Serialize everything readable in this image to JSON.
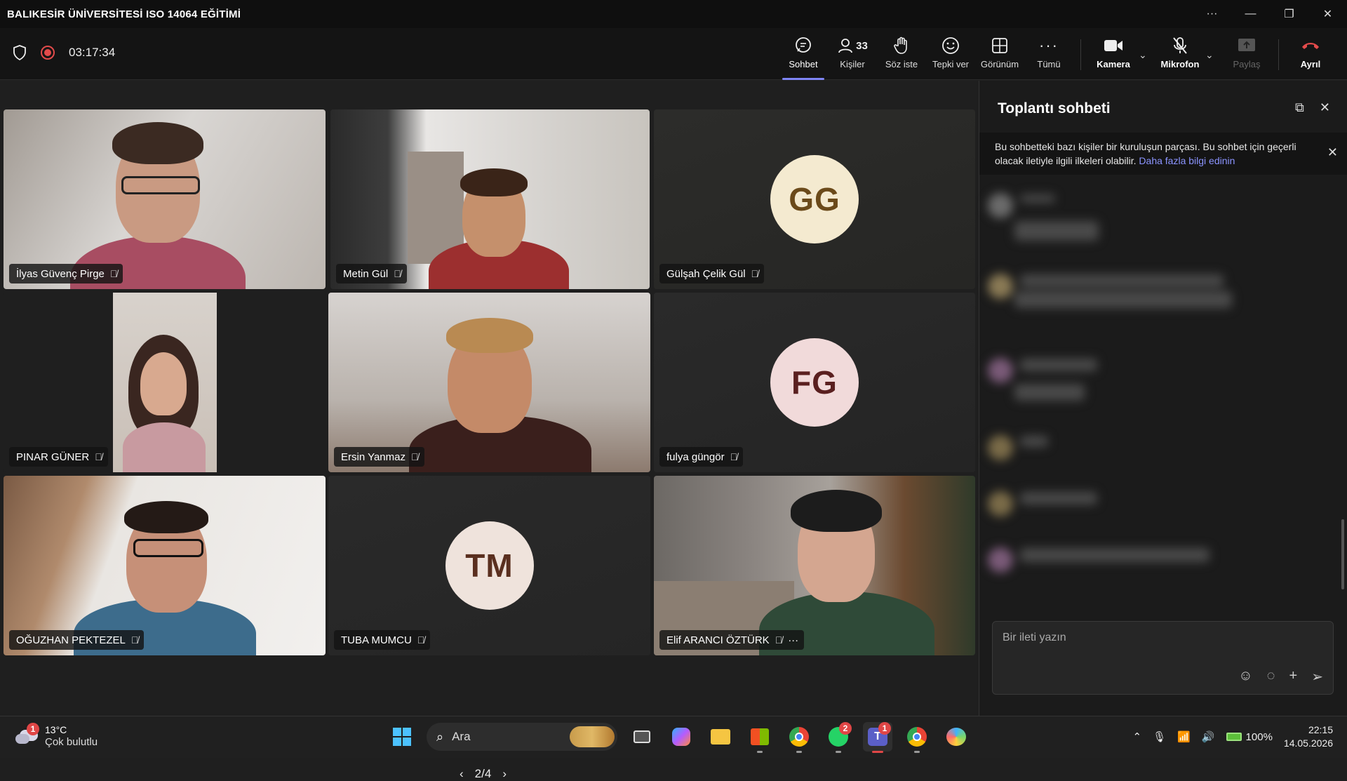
{
  "window": {
    "title": "BALIKESİR ÜNİVERSİTESİ ISO 14064 EĞİTİMİ",
    "controls": [
      "···",
      "—",
      "❐",
      "✕"
    ]
  },
  "meeting": {
    "timer": "03:17:34",
    "toolbar": {
      "chat": "Sohbet",
      "people": "Kişiler",
      "people_count": "33",
      "raise_hand": "Söz iste",
      "react": "Tepki ver",
      "view": "Görünüm",
      "more": "Tümü",
      "camera": "Kamera",
      "mic": "Mikrofon",
      "share": "Paylaş",
      "leave": "Ayrıl"
    }
  },
  "participants": [
    {
      "name": "İlyas Güvenç Pirge",
      "type": "video"
    },
    {
      "name": "Metin Gül",
      "type": "video"
    },
    {
      "name": "Gülşah Çelik Gül",
      "type": "avatar",
      "initials": "GG",
      "avatar_bg": "#f4ead0",
      "avatar_fg": "#6b4a1a"
    },
    {
      "name": "PINAR GÜNER",
      "type": "video"
    },
    {
      "name": "Ersin Yanmaz",
      "type": "video"
    },
    {
      "name": "fulya güngör",
      "type": "avatar",
      "initials": "FG",
      "avatar_bg": "#f1dada",
      "avatar_fg": "#5a1f1f"
    },
    {
      "name": "OĞUZHAN PEKTEZEL",
      "type": "video"
    },
    {
      "name": "TUBA MUMCU",
      "type": "avatar",
      "initials": "TM",
      "avatar_bg": "#efe3dc",
      "avatar_fg": "#5a2f1f"
    },
    {
      "name": "Elif ARANCI ÖZTÜRK",
      "type": "video",
      "more": "···"
    }
  ],
  "pager": {
    "label": "2/4"
  },
  "chat": {
    "title": "Toplantı sohbeti",
    "notice": "Bu sohbetteki bazı kişiler bir kuruluşun parçası. Bu sohbet için geçerli olacak iletiyle ilgili ilkeleri olabilir. ",
    "notice_link": "Daha fazla bilgi edinin",
    "composer_placeholder": "Bir ileti yazın"
  },
  "taskbar": {
    "temp": "13°C",
    "condition": "Çok bulutlu",
    "weather_badge": "1",
    "search": "Ara",
    "whatsapp_badge": "2",
    "teams_badge": "1",
    "battery": "100%",
    "time": "22:15",
    "date": "14.05.2026"
  },
  "colors": {
    "accent": "#7f85f5",
    "leave": "#e34b4b",
    "recording": "#e34b4b"
  }
}
